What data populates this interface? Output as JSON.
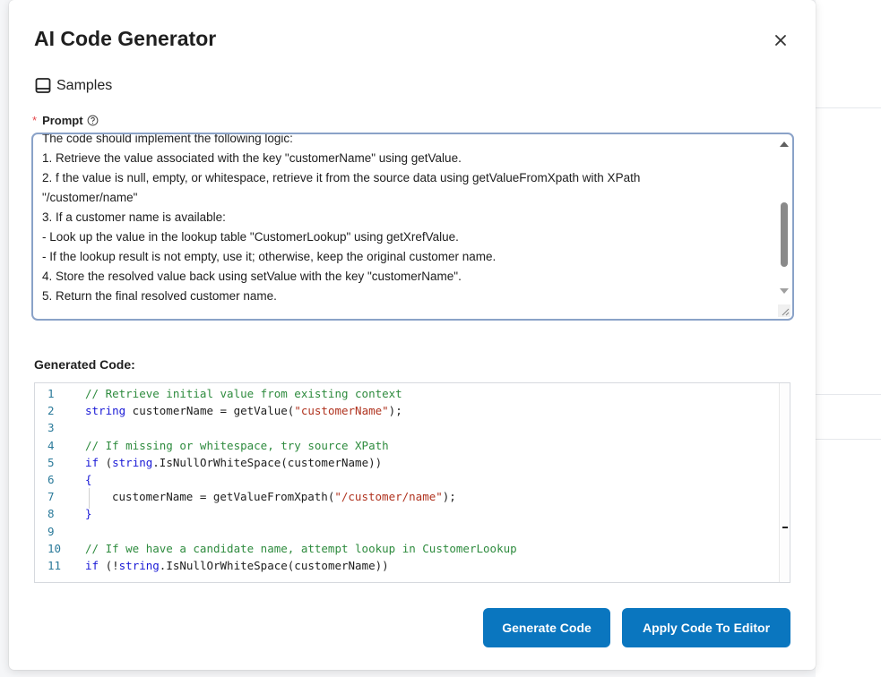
{
  "modal": {
    "title": "AI Code Generator",
    "close_icon": "close-icon"
  },
  "samples": {
    "icon": "book-icon",
    "label": "Samples"
  },
  "prompt": {
    "required_marker": "*",
    "label": "Prompt",
    "help_icon": "question-circle-icon",
    "value": "The code should implement the following logic:\n1. Retrieve the value associated with the key \"customerName\" using getValue.\n2. f the value is null, empty, or whitespace, retrieve it from the source data using getValueFromXpath with XPath \n\"/customer/name\"\n3. If a customer name is available:\n- Look up the value in the lookup table \"CustomerLookup\" using getXrefValue.\n- If the lookup result is not empty, use it; otherwise, keep the original customer name.\n4. Store the resolved value back using setValue with the key \"customerName\".\n5. Return the final resolved customer name."
  },
  "generated": {
    "label": "Generated Code:",
    "lines": [
      {
        "num": "1",
        "indent": false,
        "tokens": [
          {
            "t": "// Retrieve initial value from existing context",
            "c": "comment"
          }
        ]
      },
      {
        "num": "2",
        "indent": false,
        "tokens": [
          {
            "t": "string",
            "c": "kw"
          },
          {
            "t": " customerName = getValue(",
            "c": "plain"
          },
          {
            "t": "\"customerName\"",
            "c": "str"
          },
          {
            "t": ");",
            "c": "plain"
          }
        ]
      },
      {
        "num": "3",
        "indent": false,
        "tokens": []
      },
      {
        "num": "4",
        "indent": false,
        "tokens": [
          {
            "t": "// If missing or whitespace, try source XPath",
            "c": "comment"
          }
        ]
      },
      {
        "num": "5",
        "indent": false,
        "tokens": [
          {
            "t": "if",
            "c": "kw"
          },
          {
            "t": " (",
            "c": "plain"
          },
          {
            "t": "string",
            "c": "kw"
          },
          {
            "t": ".IsNullOrWhiteSpace(customerName))",
            "c": "plain"
          }
        ]
      },
      {
        "num": "6",
        "indent": false,
        "tokens": [
          {
            "t": "{",
            "c": "kw"
          }
        ]
      },
      {
        "num": "7",
        "indent": true,
        "tokens": [
          {
            "t": "customerName = getValueFromXpath(",
            "c": "plain"
          },
          {
            "t": "\"/customer/name\"",
            "c": "str"
          },
          {
            "t": ");",
            "c": "plain"
          }
        ]
      },
      {
        "num": "8",
        "indent": false,
        "tokens": [
          {
            "t": "}",
            "c": "kw"
          }
        ]
      },
      {
        "num": "9",
        "indent": false,
        "tokens": []
      },
      {
        "num": "10",
        "indent": false,
        "tokens": [
          {
            "t": "// If we have a candidate name, attempt lookup in CustomerLookup",
            "c": "comment"
          }
        ]
      },
      {
        "num": "11",
        "indent": false,
        "tokens": [
          {
            "t": "if",
            "c": "kw"
          },
          {
            "t": " (!",
            "c": "plain"
          },
          {
            "t": "string",
            "c": "kw"
          },
          {
            "t": ".IsNullOrWhiteSpace(customerName))",
            "c": "plain"
          }
        ]
      }
    ]
  },
  "buttons": {
    "generate": "Generate Code",
    "apply": "Apply Code To Editor"
  },
  "colors": {
    "primary": "#0a76bf",
    "comment": "#2e8b3e",
    "keyword": "#1a1ad6",
    "string": "#b0331f",
    "line_number": "#2b7a9a",
    "required": "#e5484d"
  }
}
